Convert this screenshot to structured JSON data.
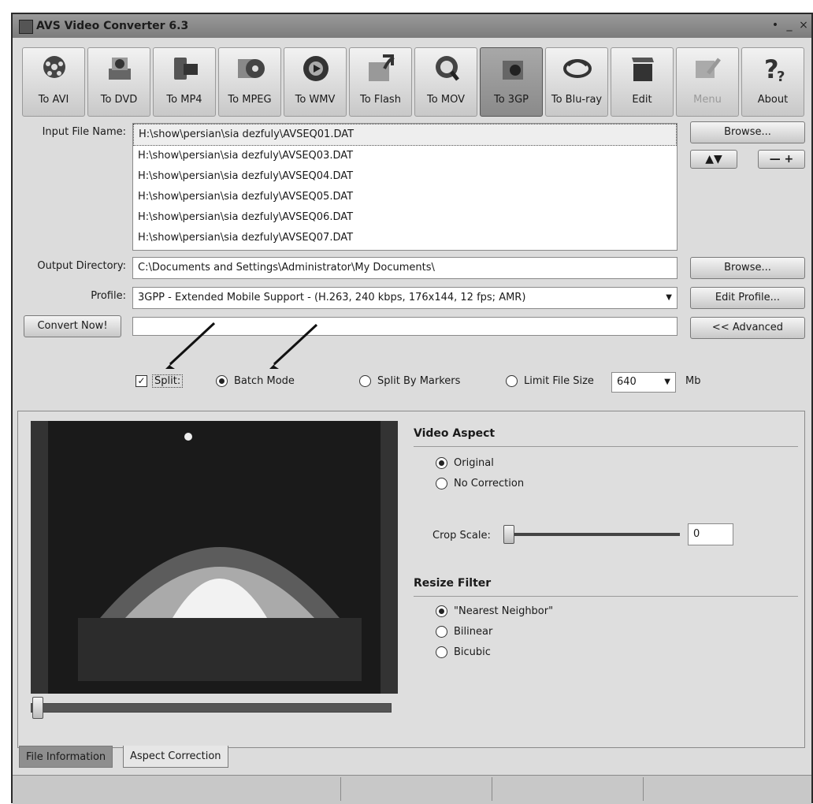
{
  "window": {
    "title": "AVS Video Converter 6.3"
  },
  "toolbar": {
    "buttons": [
      {
        "label": "To AVI",
        "icon": "film-reel-icon"
      },
      {
        "label": "To DVD",
        "icon": "dvd-icon"
      },
      {
        "label": "To MP4",
        "icon": "mp4-player-icon"
      },
      {
        "label": "To MPEG",
        "icon": "mpeg-icon"
      },
      {
        "label": "To WMV",
        "icon": "wmv-disc-icon"
      },
      {
        "label": "To Flash",
        "icon": "flash-icon"
      },
      {
        "label": "To MOV",
        "icon": "quicktime-icon"
      },
      {
        "label": "To 3GP",
        "icon": "phone-icon"
      },
      {
        "label": "To Blu-ray",
        "icon": "bluray-icon"
      },
      {
        "label": "Edit",
        "icon": "clapperboard-icon"
      },
      {
        "label": "Menu",
        "icon": "menu-icon"
      },
      {
        "label": "About",
        "icon": "question-icon"
      }
    ]
  },
  "input": {
    "label": "Input File Name:",
    "files": [
      "H:\\show\\persian\\sia dezfuly\\AVSEQ01.DAT",
      "H:\\show\\persian\\sia dezfuly\\AVSEQ03.DAT",
      "H:\\show\\persian\\sia dezfuly\\AVSEQ04.DAT",
      "H:\\show\\persian\\sia dezfuly\\AVSEQ05.DAT",
      "H:\\show\\persian\\sia dezfuly\\AVSEQ06.DAT",
      "H:\\show\\persian\\sia dezfuly\\AVSEQ07.DAT"
    ],
    "browse_label": "Browse..."
  },
  "output": {
    "label": "Output Directory:",
    "value": "C:\\Documents and Settings\\Administrator\\My Documents\\",
    "browse_label": "Browse..."
  },
  "profile": {
    "label": "Profile:",
    "value": "3GPP - Extended Mobile Support - (H.263, 240 kbps, 176x144, 12 fps; AMR)",
    "edit_label": "Edit Profile..."
  },
  "convert_label": "Convert Now!",
  "advanced_label": "<< Advanced",
  "split": {
    "checkbox_label": "Split:",
    "batch_mode": "Batch Mode",
    "by_markers": "Split By Markers",
    "limit_size": "Limit File Size",
    "size_value": "640",
    "size_unit": "Mb"
  },
  "aspect": {
    "video_aspect_title": "Video Aspect",
    "original": "Original",
    "no_correction": "No Correction",
    "crop_label": "Crop Scale:",
    "crop_value": "0",
    "resize_title": "Resize Filter",
    "nearest": "\"Nearest Neighbor\"",
    "bilinear": "Bilinear",
    "bicubic": "Bicubic"
  },
  "tabs": {
    "file_info": "File Information",
    "aspect_correction": "Aspect Correction"
  },
  "colors": {
    "arrow": "#111111"
  }
}
